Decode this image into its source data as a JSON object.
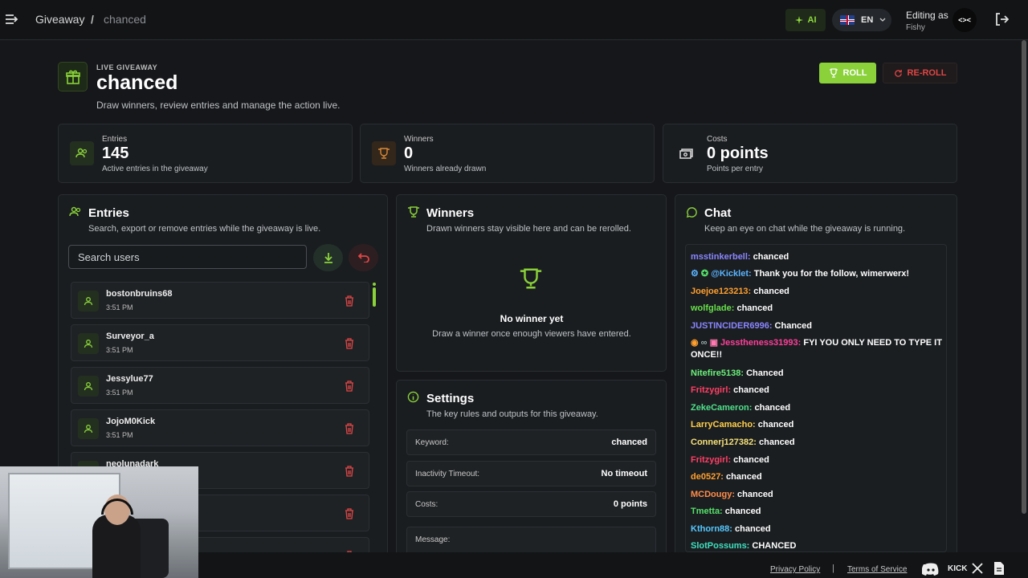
{
  "topbar": {
    "breadcrumb_root": "Giveaway",
    "breadcrumb_sep": "/",
    "breadcrumb_current": "chanced",
    "ai_label": "AI",
    "lang_label": "EN",
    "editing_label": "Editing as",
    "editing_user": "Fishy",
    "avatar_text": "<><"
  },
  "header": {
    "live_label": "LIVE GIVEAWAY",
    "title": "chanced",
    "subtitle": "Draw winners, review entries and manage the action live.",
    "roll_label": "ROLL",
    "reroll_label": "RE-ROLL"
  },
  "stats": {
    "entries": {
      "label": "Entries",
      "value": "145",
      "desc": "Active entries in the giveaway"
    },
    "winners": {
      "label": "Winners",
      "value": "0",
      "desc": "Winners already drawn"
    },
    "costs": {
      "label": "Costs",
      "value": "0 points",
      "desc": "Points per entry"
    }
  },
  "entries_panel": {
    "title": "Entries",
    "subtitle": "Search, export or remove entries while the giveaway is live.",
    "search_placeholder": "Search users",
    "items": [
      {
        "name": "bostonbruins68",
        "time": "3:51 PM"
      },
      {
        "name": "Surveyor_a",
        "time": "3:51 PM"
      },
      {
        "name": "Jessylue77",
        "time": "3:51 PM"
      },
      {
        "name": "JojoM0Kick",
        "time": "3:51 PM"
      },
      {
        "name": "neolunadark",
        "time": ""
      },
      {
        "name": "",
        "time": ""
      },
      {
        "name": "",
        "time": ""
      }
    ]
  },
  "winners_panel": {
    "title": "Winners",
    "subtitle": "Drawn winners stay visible here and can be rerolled.",
    "empty_title": "No winner yet",
    "empty_sub": "Draw a winner once enough viewers have entered."
  },
  "settings_panel": {
    "title": "Settings",
    "subtitle": "The key rules and outputs for this giveaway.",
    "rows": [
      {
        "key": "Keyword:",
        "value": "chanced"
      },
      {
        "key": "Inactivity Timeout:",
        "value": "No timeout"
      },
      {
        "key": "Costs:",
        "value": "0 points"
      },
      {
        "key": "Message:",
        "value": ""
      }
    ]
  },
  "chat_panel": {
    "title": "Chat",
    "subtitle": "Keep an eye on chat while the giveaway is running.",
    "messages": [
      {
        "user": "msstinkerbell:",
        "text": " chanced",
        "color": "#8a86ff"
      },
      {
        "user": "@Kicklet:",
        "text": " Thank you for the follow, wimerwerx!",
        "color": "#5ab4ff"
      },
      {
        "user": "Joejoe123213:",
        "text": " chanced",
        "color": "#ff9f2e"
      },
      {
        "user": "wolfglade:",
        "text": " chanced",
        "color": "#67e04a"
      },
      {
        "user": "JUSTINCIDER6996:",
        "text": " Chanced",
        "color": "#8a86ff"
      },
      {
        "user": "Jesstheness31993:",
        "text": " FYI YOU ONLY NEED TO TYPE IT ONCE!!",
        "color": "#ff3f9a"
      },
      {
        "user": "Nitefire5138:",
        "text": " Chanced",
        "color": "#6bf07a"
      },
      {
        "user": "Fritzygirl:",
        "text": " chanced",
        "color": "#ff3f66"
      },
      {
        "user": "ZekeCameron:",
        "text": " chanced",
        "color": "#4fe08a"
      },
      {
        "user": "LarryCamacho:",
        "text": " chanced",
        "color": "#ffcf4a"
      },
      {
        "user": "Connerj127382:",
        "text": " chanced",
        "color": "#f5e07a"
      },
      {
        "user": "Fritzygirl:",
        "text": " chanced",
        "color": "#ff3f66"
      },
      {
        "user": "de0527:",
        "text": " chanced",
        "color": "#ff9f2e"
      },
      {
        "user": "MCDougy:",
        "text": " chanced",
        "color": "#ff8c4a"
      },
      {
        "user": "Tmetta:",
        "text": " chanced",
        "color": "#55e06a"
      },
      {
        "user": "Kthorn88:",
        "text": " chanced",
        "color": "#55c8ff"
      },
      {
        "user": "SlotPossums:",
        "text": " CHANCED",
        "color": "#3fe0c0"
      }
    ]
  },
  "footer": {
    "privacy": "Privacy Policy",
    "sep": "|",
    "terms": "Terms of Service",
    "kick": "KICK"
  },
  "colors": {
    "accent": "#8ad13a",
    "danger": "#e04646",
    "bg": "#15171a"
  }
}
